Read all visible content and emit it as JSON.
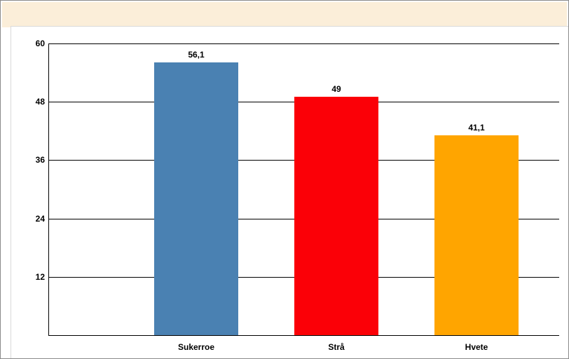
{
  "chart_data": {
    "type": "bar",
    "categories": [
      "Sukerroe",
      "Strå",
      "Hvete"
    ],
    "values": [
      56.1,
      49,
      41.1
    ],
    "value_labels": [
      "56,1",
      "49",
      "41,1"
    ],
    "colors": [
      "#4a81b2",
      "#fb0007",
      "#ffa500"
    ],
    "ylim": [
      0,
      60
    ],
    "yticks": [
      12,
      24,
      36,
      48,
      60
    ],
    "title": "",
    "xlabel": "",
    "ylabel": ""
  }
}
